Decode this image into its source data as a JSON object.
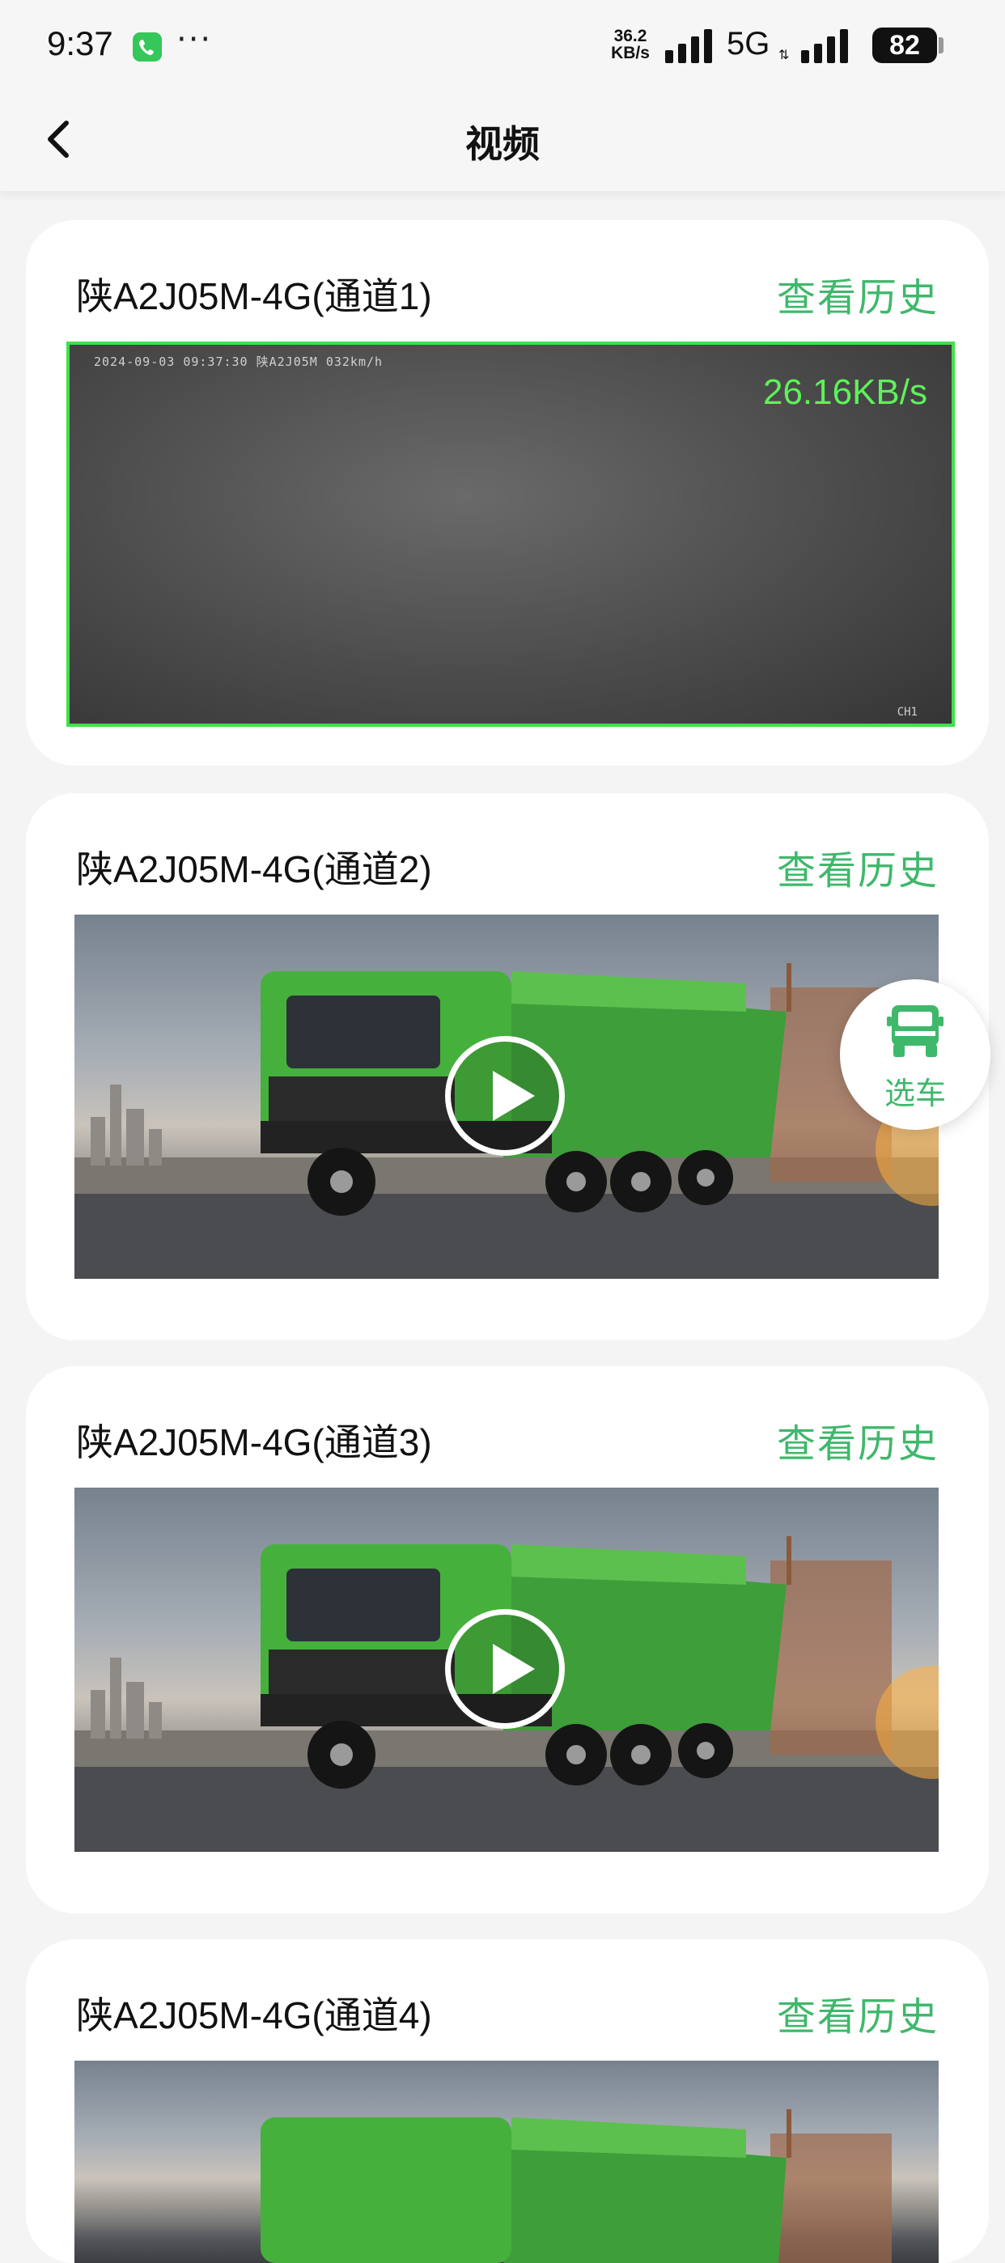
{
  "status_bar": {
    "time": "9:37",
    "more": "···",
    "net_speed_value": "36.2",
    "net_speed_unit": "KB/s",
    "network": "5G",
    "battery": "82"
  },
  "header": {
    "title": "视频"
  },
  "cards": [
    {
      "title": "陕A2J05M-4G(通道1)",
      "history_label": "查看历史",
      "live": true,
      "osd_text": "2024-09-03 09:37:30  陕A2J05M  032km/h",
      "bitrate": "26.16KB/s",
      "channel_label": "CH1"
    },
    {
      "title": "陕A2J05M-4G(通道2)",
      "history_label": "查看历史",
      "live": false
    },
    {
      "title": "陕A2J05M-4G(通道3)",
      "history_label": "查看历史",
      "live": false
    },
    {
      "title": "陕A2J05M-4G(通道4)",
      "history_label": "查看历史",
      "live": false
    }
  ],
  "fab": {
    "label": "选车",
    "icon": "truck-icon"
  },
  "colors": {
    "accent": "#3fb86b",
    "live_border": "#3fe04a",
    "bitrate": "#5df25a"
  }
}
